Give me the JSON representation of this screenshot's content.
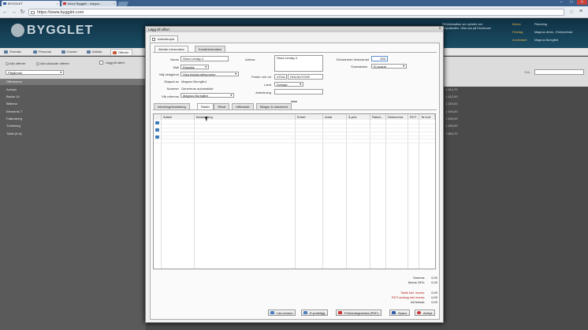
{
  "browser": {
    "tabs": [
      {
        "label": "BYGGLET"
      },
      {
        "label": "Inbox Bygglet - magnu..."
      }
    ],
    "url": "https://www.bygglet.com"
  },
  "header": {
    "logo": "BYGGLET",
    "facebook_note_line1": "Få information om nyheter och",
    "facebook_note_line2": "erbjudanden. Gilla oss på Facebook!",
    "labels": [
      "Modul:",
      "Företag:",
      "Användare:"
    ],
    "values": [
      "Planering",
      "Magnus demo - Entreprenad",
      "Magnus Buregård"
    ]
  },
  "nav": {
    "tabs": [
      "Översikt",
      "Personal",
      "Kunder",
      "Artiklar",
      "Offerter"
    ],
    "active": "Offerter"
  },
  "subbar": {
    "radio_all": "Alla offerter",
    "radio_sent": "Alla skickade offerter",
    "add_offer": "Lägg till offert",
    "status_select": "Pågående",
    "search_label": "Sök:"
  },
  "offer_list": {
    "header": "Offertnamn",
    "rows": [
      "Avenyn",
      "Backa 14",
      "Bitterna",
      "Elemento 7",
      "Falkenberg",
      "Trelleborg",
      "Totalt (6 st)"
    ]
  },
  "right_columns": {
    "headers": [
      "Pris",
      "Anteckning"
    ],
    "prices": [
      "1 414,70",
      "1 412,00",
      "1 220,00",
      "1 400,00",
      "1 400,00",
      "1 400,00",
      "7 854,70"
    ]
  },
  "dialog": {
    "title": "Lägg till offert",
    "close": "×",
    "outer_tab": "Arbetskopia",
    "tabs": [
      "Allmän information",
      "Kundinformation"
    ],
    "form": {
      "name_label": "Namn",
      "name_value": "Stora Levaig 4",
      "mall_label": "Mall",
      "mall_value": "Klassisk",
      "dela_label": "Välj delagörvá",
      "dela_value": "Visa endast delsummor",
      "skapad_label": "Skapad av",
      "skapad_value": "Magnus Buregård",
      "nummer_label": "Nummer",
      "nummer_value": "Genereras automatiskt",
      "referens_label": "Vår referens",
      "referens_value": "Magnus Buregård",
      "adress_label": "Adress",
      "adress_value": "Stora Levaig 4",
      "post_label": "Postnr och ort",
      "postnr_value": "47041",
      "ort_value": "HOLNUYCHE",
      "land_label": "Land",
      "land_value": "Sverige",
      "anteckning_label": "Anteckning",
      "timpris_label": "Extraarbete timkostnad",
      "timpris_value": "400",
      "svarsstatus_label": "Svarsstatus",
      "svarsstatus_value": "Ej avarat"
    },
    "row_tabs": [
      "Inledning/Avslutning",
      "Rader",
      "Tillval",
      "Utförande",
      "Bilagor & dokument"
    ],
    "row_tabs_active": "Rader",
    "grid": {
      "columns": [
        "Artikel",
        "Beskrivning",
        "Enhet",
        "Antal",
        "À-pris",
        "Rabat...",
        "Delsumma",
        "ROT",
        "Ta bort"
      ]
    },
    "summary": {
      "labels": [
        "Summa:",
        "Moms 25%:",
        "Totalt inkl. moms:",
        "ROT-avdrag inkl moms:",
        "Att betala:"
      ],
      "values": [
        "0,00",
        "0,00",
        "0,00",
        "0,00",
        "0,00"
      ]
    },
    "buttons": [
      "Läs version",
      "E-postlägg",
      "Förhandsgranska (PDF)",
      "Spara",
      "Avbryt"
    ]
  }
}
